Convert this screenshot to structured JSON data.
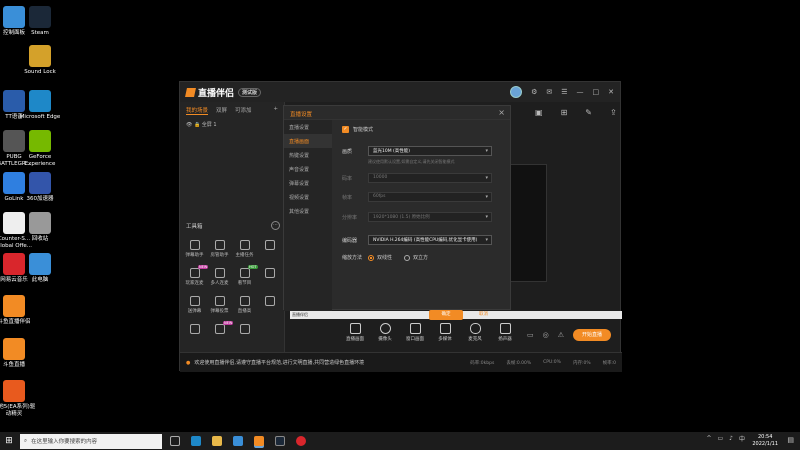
{
  "desktop": {
    "icons": [
      {
        "label": "控制面板",
        "icon": "control-panel-icon",
        "color": "#3a8fd8"
      },
      {
        "label": "Steam",
        "icon": "steam-icon",
        "color": "#1b2838"
      },
      {
        "label": "Sound Lock",
        "icon": "lock-icon",
        "color": "#d4a12a"
      },
      {
        "label": "TT语音",
        "icon": "tt-voice-icon",
        "color": "#2a5caa"
      },
      {
        "label": "Microsoft Edge",
        "icon": "edge-icon",
        "color": "#1e88c8"
      },
      {
        "label": "PUBG BATTLEGR...",
        "icon": "pubg-icon",
        "color": "#555555"
      },
      {
        "label": "GeForce Experience",
        "icon": "geforce-icon",
        "color": "#76b900"
      },
      {
        "label": "GoLink",
        "icon": "golink-icon",
        "color": "#2f7fe0"
      },
      {
        "label": "360加速器",
        "icon": "accelerator-icon",
        "color": "#3355aa"
      },
      {
        "label": "Counter-S... Global Offe...",
        "icon": "document-icon",
        "color": "#eeeeee"
      },
      {
        "label": "回收站",
        "icon": "recycle-bin-icon",
        "color": "#999999"
      },
      {
        "label": "网易云音乐",
        "icon": "netease-music-icon",
        "color": "#d9262c"
      },
      {
        "label": "此电脑",
        "icon": "computer-icon",
        "color": "#3a8fd8"
      },
      {
        "label": "斗鱼直播伴侣",
        "icon": "douyu-companion-icon",
        "color": "#f28b24"
      },
      {
        "label": "斗鱼直播",
        "icon": "douyu-icon",
        "color": "#f28b24"
      },
      {
        "label": "战地5(EA系列)驱动精灵",
        "icon": "game-icon",
        "color": "#e85a1e"
      }
    ]
  },
  "app": {
    "title": "直播伴侣",
    "version": "测试版",
    "scene_tabs": [
      "我的场景",
      "双屏",
      "可添加"
    ],
    "scene_row": "全屏 1",
    "tools_title": "工具箱",
    "tools": [
      {
        "label": "弹幕助手",
        "badge": ""
      },
      {
        "label": "房管助手",
        "badge": ""
      },
      {
        "label": "主播任务",
        "badge": ""
      },
      {
        "label": "",
        "badge": ""
      },
      {
        "label": "玩家连麦",
        "badge": "NEW"
      },
      {
        "label": "多人连麦",
        "badge": ""
      },
      {
        "label": "看节目",
        "badge": "HOT"
      },
      {
        "label": "",
        "badge": ""
      },
      {
        "label": "送弹幕",
        "badge": ""
      },
      {
        "label": "弹幕投票",
        "badge": ""
      },
      {
        "label": "直播高",
        "badge": ""
      },
      {
        "label": "",
        "badge": ""
      },
      {
        "label": "",
        "badge": ""
      },
      {
        "label": "",
        "badge": "NEW"
      },
      {
        "label": "",
        "badge": ""
      }
    ],
    "notice": "欢迎使用直播伴侣,请遵守直播平台规范,进行文明直播,共同营造绿色直播环境",
    "stats": [
      "码率:0kbps",
      "丢帧:0.00%",
      "CPU:0%",
      "内存:0%",
      "帧率:0"
    ],
    "actions": [
      "直播画面",
      "摄像头",
      "窗口画面",
      "多媒体",
      "麦克风",
      "扬声器"
    ],
    "start_button": "开始直播",
    "strip_text": "直播伴侣"
  },
  "dialog": {
    "title": "直播设置",
    "nav": [
      "直播设置",
      "直播画面",
      "热键设置",
      "声音设置",
      "弹幕设置",
      "视频设置",
      "其他设置"
    ],
    "active_nav": 1,
    "smart_mode_label": "智能模式",
    "quality_label": "画质",
    "quality_value": "蓝光10M (高性能)",
    "quality_hint": "建议使用默认设置,如需自定义,请先关闭智能模式",
    "bitrate_label": "码率",
    "bitrate_value": "10000",
    "fps_label": "帧率",
    "fps_value": "60fps",
    "resolution_label": "分辨率",
    "resolution_value": "1920*1080 (1.5) 原始比例",
    "encoder_label": "编码器",
    "encoder_value": "NVIDIA H.264编码 (高性能CPU编码,优化显卡使用)",
    "scale_label": "缩放方法",
    "scale_options": [
      "双线性",
      "双立方"
    ],
    "ok_button": "确定",
    "cancel_button": "取消"
  },
  "taskbar": {
    "search_placeholder": "在这里输入你要搜索的内容",
    "time": "20:54",
    "date": "2022/1/11"
  }
}
